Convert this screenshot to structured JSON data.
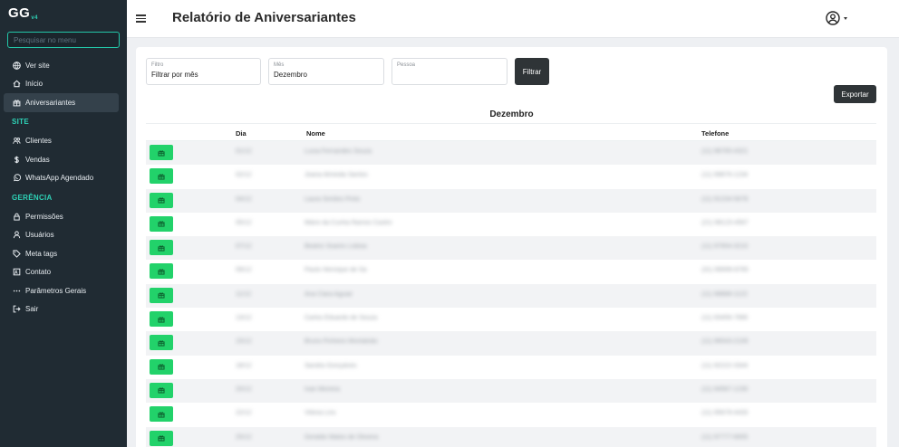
{
  "app": {
    "logo": "GG",
    "logo_version": "v4"
  },
  "sidebar": {
    "search_placeholder": "Pesquisar no menu",
    "items_top": [
      {
        "label": "Ver site",
        "icon": "globe-icon"
      },
      {
        "label": "Início",
        "icon": "home-icon"
      },
      {
        "label": "Aniversariantes",
        "icon": "gift-icon",
        "active": true
      }
    ],
    "section_site": "SITE",
    "items_site": [
      {
        "label": "Clientes",
        "icon": "users-icon"
      },
      {
        "label": "Vendas",
        "icon": "dollar-icon"
      },
      {
        "label": "WhatsApp Agendado",
        "icon": "whatsapp-icon"
      }
    ],
    "section_gerencia": "GERÊNCIA",
    "items_gerencia": [
      {
        "label": "Permissões",
        "icon": "lock-icon"
      },
      {
        "label": "Usuários",
        "icon": "user-icon"
      },
      {
        "label": "Meta tags",
        "icon": "tag-icon"
      },
      {
        "label": "Contato",
        "icon": "contact-icon"
      },
      {
        "label": "Parâmetros Gerais",
        "icon": "dots-icon"
      },
      {
        "label": "Sair",
        "icon": "logout-icon"
      }
    ]
  },
  "header": {
    "title": "Relatório de Aniversariantes"
  },
  "filters": {
    "filtro": {
      "label": "Filtro",
      "value": "Filtrar por mês"
    },
    "mes": {
      "label": "Mês",
      "value": "Dezembro"
    },
    "pessoa": {
      "label": "Pessoa",
      "value": ""
    },
    "filter_button": "Filtrar",
    "export_button": "Exportar"
  },
  "table": {
    "group_title": "Dezembro",
    "headers": {
      "day": "Dia",
      "name": "Nome",
      "phone": "Telefone"
    },
    "rows": [
      {
        "day": "01/12",
        "name": "Lucia Fernandes Souza",
        "phone": "(11) 98765-4321"
      },
      {
        "day": "02/12",
        "name": "Joana Almeida Santos",
        "phone": "(11) 99876-1234"
      },
      {
        "day": "04/12",
        "name": "Laura Simões Pinto",
        "phone": "(11) 91234-5678"
      },
      {
        "day": "05/12",
        "name": "Mário da Cunha Ramos Castro",
        "phone": "(21) 98123-4567"
      },
      {
        "day": "07/12",
        "name": "Beatriz Soares Lisboa",
        "phone": "(11) 97654-3210"
      },
      {
        "day": "09/12",
        "name": "Paulo Henrique de Sá",
        "phone": "(31) 99999-8765"
      },
      {
        "day": "11/12",
        "name": "Ana Clara Aguiar",
        "phone": "(11) 98888-1122"
      },
      {
        "day": "13/12",
        "name": "Carlos Eduardo de Souza",
        "phone": "(11) 93456-7890"
      },
      {
        "day": "15/12",
        "name": "Bruno Pinheiro Montalvão",
        "phone": "(11) 96543-2109"
      },
      {
        "day": "18/12",
        "name": "Sandra Gonçalves",
        "phone": "(11) 92222-3344"
      },
      {
        "day": "20/12",
        "name": "Ivan Moreira",
        "phone": "(11) 94567-1230"
      },
      {
        "day": "22/12",
        "name": "Vitória Lins",
        "phone": "(11) 95678-4433"
      },
      {
        "day": "25/12",
        "name": "Geraldo Matos de Oliveira",
        "phone": "(11) 97777-6655"
      }
    ]
  }
}
